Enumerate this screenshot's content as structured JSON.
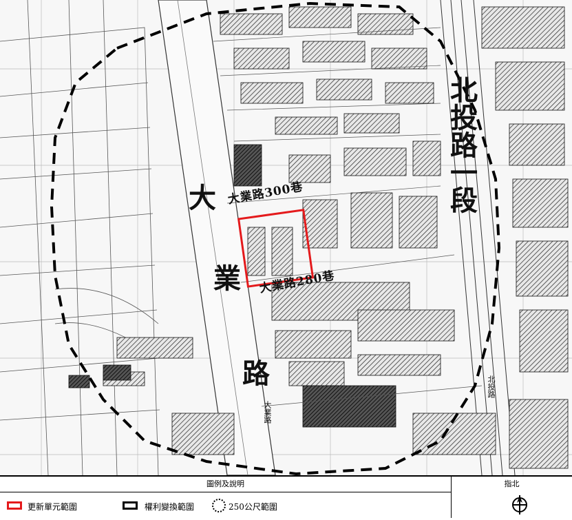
{
  "map": {
    "labels": {
      "dayelu": "大業路",
      "dayelu_300": "大業路300巷",
      "dayelu_280": "大業路280巷",
      "beitou_rd_sec1": "北投路一段",
      "beitou_rd_small": "北投路",
      "dayelu_small": "大業路"
    }
  },
  "legend": {
    "title": "圖例及說明",
    "north_title": "指北",
    "items": [
      {
        "label": "更新單元範圍",
        "color": "#e41a1c"
      },
      {
        "label": "權利變換範圍",
        "color": "#000000"
      },
      {
        "label": "250公尺範圍",
        "color": "#000000"
      }
    ],
    "north_symbol": "N"
  }
}
